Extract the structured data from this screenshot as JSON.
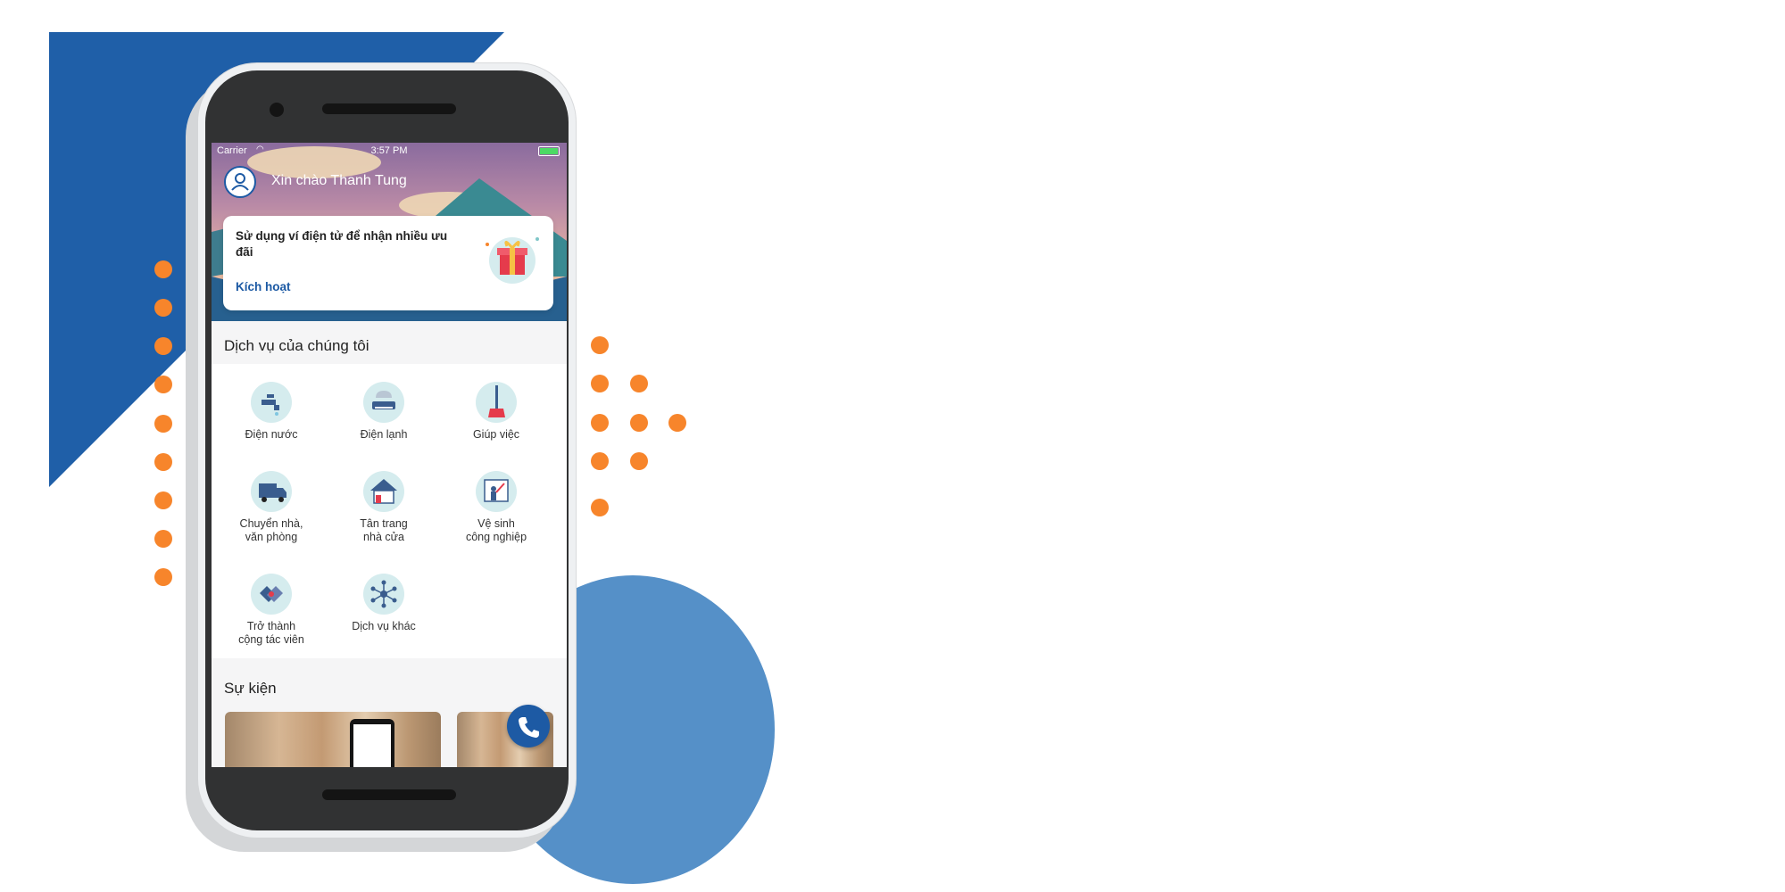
{
  "colors": {
    "brand_blue": "#1d5aa4",
    "accent_orange": "#f7852b",
    "circle_blue": "#5590c8",
    "icon_bg": "#d5ecee"
  },
  "status_bar": {
    "carrier": "Carrier",
    "time": "3:57 PM"
  },
  "header": {
    "greeting": "Xin chào Thanh Tung",
    "avatar_icon": "user-icon"
  },
  "promo": {
    "text": "Sử dụng ví điện tử để nhận nhiều ưu đãi",
    "link": "Kích hoạt",
    "icon": "gift-icon"
  },
  "services": {
    "title": "Dịch vụ của chúng tôi",
    "items": [
      {
        "label": "Điện nước",
        "icon": "faucet-icon"
      },
      {
        "label": "Điện lạnh",
        "icon": "air-conditioner-icon"
      },
      {
        "label": "Giúp việc",
        "icon": "broom-icon"
      },
      {
        "label": "Chuyển nhà,\nvăn phòng",
        "icon": "truck-icon"
      },
      {
        "label": "Tân trang\nnhà cửa",
        "icon": "house-icon"
      },
      {
        "label": "Vệ sinh\ncông nghiệp",
        "icon": "cleaner-icon"
      },
      {
        "label": "Trở thành\ncộng tác viên",
        "icon": "handshake-icon"
      },
      {
        "label": "Dịch vụ khác",
        "icon": "network-icon"
      }
    ]
  },
  "events": {
    "title": "Sự kiện"
  },
  "fab": {
    "icon": "phone-icon"
  }
}
